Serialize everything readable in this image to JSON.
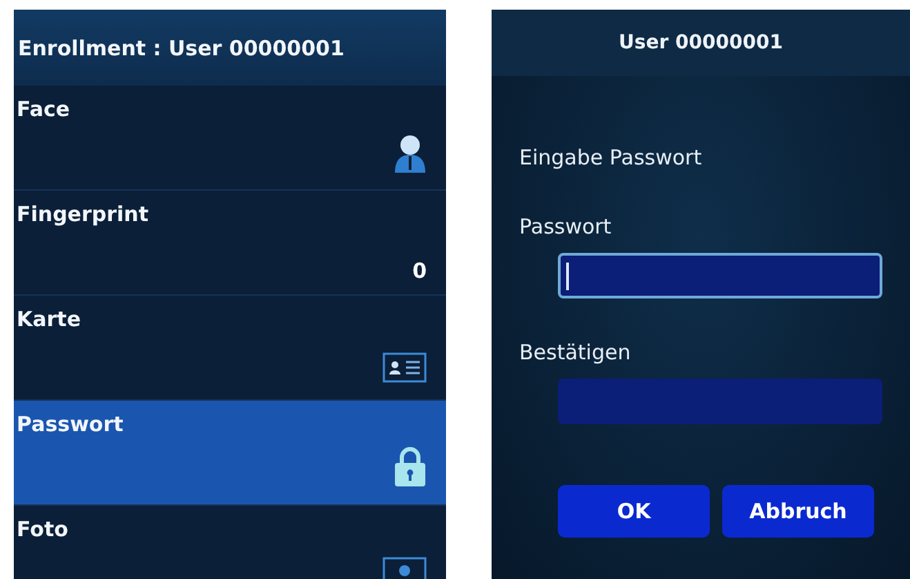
{
  "enrollment_screen": {
    "title": "Enrollment : User 00000001",
    "items": [
      {
        "label": "Face",
        "kind": "face",
        "selected": false
      },
      {
        "label": "Fingerprint",
        "kind": "count",
        "count": "0",
        "selected": false
      },
      {
        "label": "Karte",
        "kind": "card",
        "selected": false
      },
      {
        "label": "Passwort",
        "kind": "lock",
        "selected": true
      },
      {
        "label": "Foto",
        "kind": "photo",
        "selected": false
      }
    ]
  },
  "password_screen": {
    "title": "User 00000001",
    "prompt": "Eingabe Passwort",
    "fields": [
      {
        "label": "Passwort",
        "focused": true
      },
      {
        "label": "Bestätigen",
        "focused": false
      }
    ],
    "buttons": [
      "OK",
      "Abbruch"
    ]
  }
}
